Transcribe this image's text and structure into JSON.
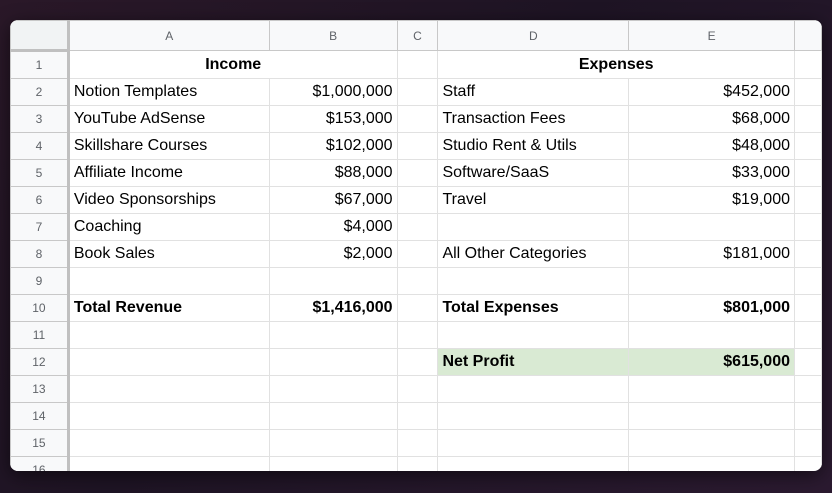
{
  "columns": [
    "A",
    "B",
    "C",
    "D",
    "E"
  ],
  "rows": [
    "1",
    "2",
    "3",
    "4",
    "5",
    "6",
    "7",
    "8",
    "9",
    "10",
    "11",
    "12",
    "13",
    "14",
    "15",
    "16"
  ],
  "income": {
    "header": "Income",
    "items": [
      {
        "label": "Notion Templates",
        "value": "$1,000,000"
      },
      {
        "label": "YouTube AdSense",
        "value": "$153,000"
      },
      {
        "label": "Skillshare Courses",
        "value": "$102,000"
      },
      {
        "label": "Affiliate Income",
        "value": "$88,000"
      },
      {
        "label": "Video Sponsorships",
        "value": "$67,000"
      },
      {
        "label": "Coaching",
        "value": "$4,000"
      },
      {
        "label": "Book Sales",
        "value": "$2,000"
      }
    ],
    "total_label": "Total Revenue",
    "total_value": "$1,416,000"
  },
  "expenses": {
    "header": "Expenses",
    "items": [
      {
        "label": "Staff",
        "value": "$452,000"
      },
      {
        "label": "Transaction Fees",
        "value": "$68,000"
      },
      {
        "label": "Studio Rent & Utils",
        "value": "$48,000"
      },
      {
        "label": "Software/SaaS",
        "value": "$33,000"
      },
      {
        "label": "Travel",
        "value": "$19,000"
      }
    ],
    "other_label": "All Other Categories",
    "other_value": "$181,000",
    "total_label": "Total Expenses",
    "total_value": "$801,000"
  },
  "net_profit": {
    "label": "Net Profit",
    "value": "$615,000",
    "highlight_color": "#d9ead3"
  }
}
